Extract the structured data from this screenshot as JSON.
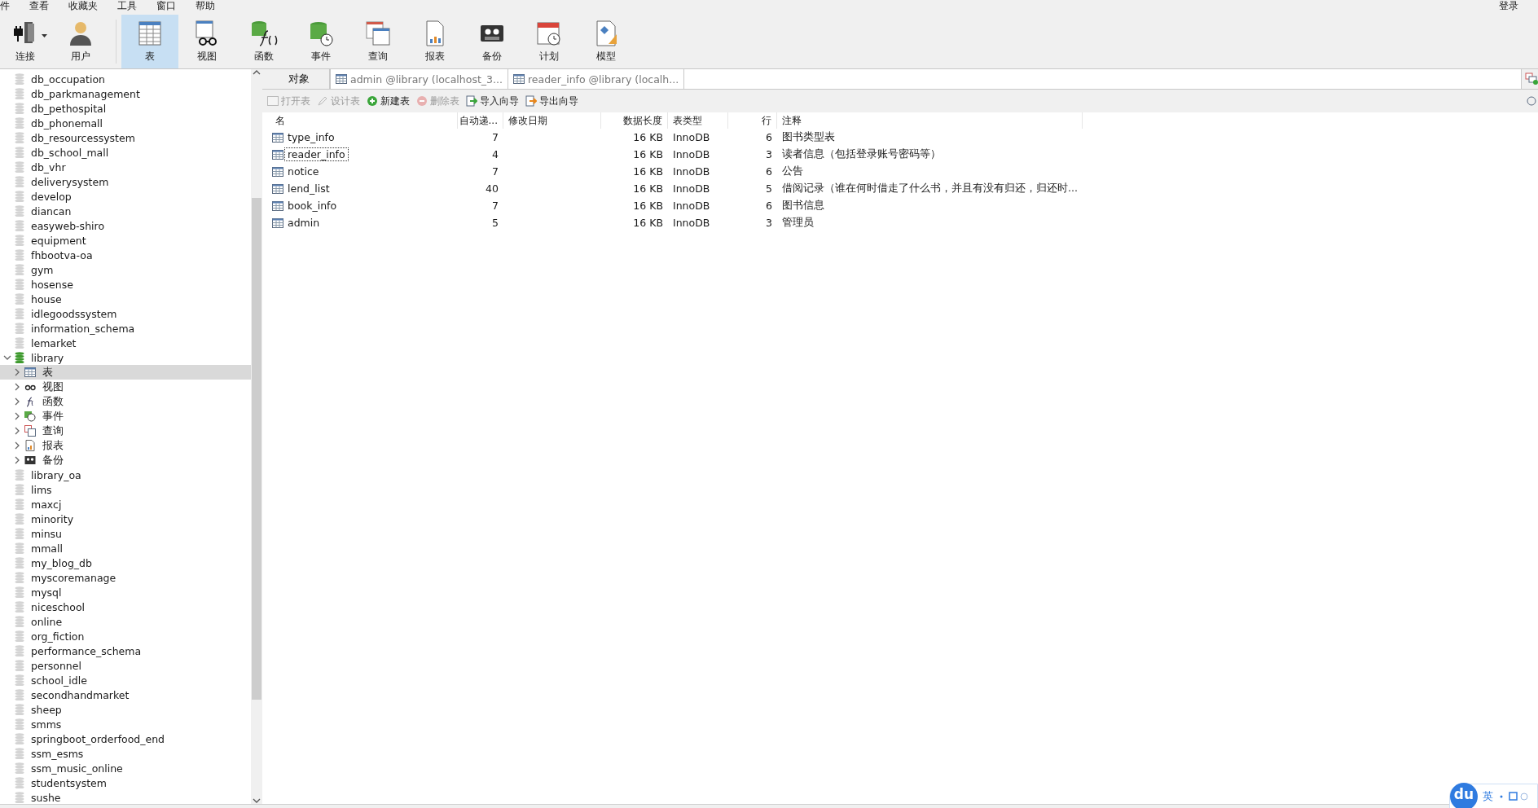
{
  "menu": [
    "件",
    "查看",
    "收藏夹",
    "工具",
    "窗口",
    "帮助"
  ],
  "login": "登录",
  "toolbar": [
    {
      "kind": "connect",
      "label": "连接",
      "selected": false,
      "dropdown": true
    },
    {
      "kind": "user",
      "label": "用户",
      "selected": false,
      "dropdown": false
    },
    {
      "kind": "separator"
    },
    {
      "kind": "table",
      "label": "表",
      "selected": true,
      "dropdown": false
    },
    {
      "kind": "view",
      "label": "视图",
      "selected": false,
      "dropdown": false
    },
    {
      "kind": "function",
      "label": "函数",
      "selected": false,
      "dropdown": false
    },
    {
      "kind": "event",
      "label": "事件",
      "selected": false,
      "dropdown": false
    },
    {
      "kind": "query",
      "label": "查询",
      "selected": false,
      "dropdown": false
    },
    {
      "kind": "report",
      "label": "报表",
      "selected": false,
      "dropdown": false
    },
    {
      "kind": "backup",
      "label": "备份",
      "selected": false,
      "dropdown": false
    },
    {
      "kind": "schedule",
      "label": "计划",
      "selected": false,
      "dropdown": false
    },
    {
      "kind": "model",
      "label": "模型",
      "selected": false,
      "dropdown": false
    }
  ],
  "sidebar": {
    "items": [
      {
        "kind": "database",
        "name": "db_occupation",
        "expanded": false
      },
      {
        "kind": "database",
        "name": "db_parkmanagement",
        "expanded": false
      },
      {
        "kind": "database",
        "name": "db_pethospital",
        "expanded": false
      },
      {
        "kind": "database",
        "name": "db_phonemall",
        "expanded": false
      },
      {
        "kind": "database",
        "name": "db_resourcessystem",
        "expanded": false
      },
      {
        "kind": "database",
        "name": "db_school_mall",
        "expanded": false
      },
      {
        "kind": "database",
        "name": "db_vhr",
        "expanded": false
      },
      {
        "kind": "database",
        "name": "deliverysystem",
        "expanded": false
      },
      {
        "kind": "database",
        "name": "develop",
        "expanded": false
      },
      {
        "kind": "database",
        "name": "diancan",
        "expanded": false
      },
      {
        "kind": "database",
        "name": "easyweb-shiro",
        "expanded": false
      },
      {
        "kind": "database",
        "name": "equipment",
        "expanded": false
      },
      {
        "kind": "database",
        "name": "fhbootva-oa",
        "expanded": false
      },
      {
        "kind": "database",
        "name": "gym",
        "expanded": false
      },
      {
        "kind": "database",
        "name": "hosense",
        "expanded": false
      },
      {
        "kind": "database",
        "name": "house",
        "expanded": false
      },
      {
        "kind": "database",
        "name": "idlegoodssystem",
        "expanded": false
      },
      {
        "kind": "database",
        "name": "information_schema",
        "expanded": false
      },
      {
        "kind": "database",
        "name": "lemarket",
        "expanded": false
      },
      {
        "kind": "database",
        "name": "library",
        "expanded": true,
        "children": [
          {
            "kind": "table",
            "name": "表",
            "expanded": false,
            "selected": true
          },
          {
            "kind": "view",
            "name": "视图",
            "expanded": false,
            "selected": false
          },
          {
            "kind": "function",
            "name": "函数",
            "expanded": false,
            "selected": false
          },
          {
            "kind": "event",
            "name": "事件",
            "expanded": false,
            "selected": false
          },
          {
            "kind": "query",
            "name": "查询",
            "expanded": false,
            "selected": false
          },
          {
            "kind": "report",
            "name": "报表",
            "expanded": false,
            "selected": false
          },
          {
            "kind": "backup",
            "name": "备份",
            "expanded": false,
            "selected": false
          }
        ]
      },
      {
        "kind": "database",
        "name": "library_oa",
        "expanded": false
      },
      {
        "kind": "database",
        "name": "lims",
        "expanded": false
      },
      {
        "kind": "database",
        "name": "maxcj",
        "expanded": false
      },
      {
        "kind": "database",
        "name": "minority",
        "expanded": false
      },
      {
        "kind": "database",
        "name": "minsu",
        "expanded": false
      },
      {
        "kind": "database",
        "name": "mmall",
        "expanded": false
      },
      {
        "kind": "database",
        "name": "my_blog_db",
        "expanded": false
      },
      {
        "kind": "database",
        "name": "myscoremanage",
        "expanded": false
      },
      {
        "kind": "database",
        "name": "mysql",
        "expanded": false
      },
      {
        "kind": "database",
        "name": "niceschool",
        "expanded": false
      },
      {
        "kind": "database",
        "name": "online",
        "expanded": false
      },
      {
        "kind": "database",
        "name": "org_fiction",
        "expanded": false
      },
      {
        "kind": "database",
        "name": "performance_schema",
        "expanded": false
      },
      {
        "kind": "database",
        "name": "personnel",
        "expanded": false
      },
      {
        "kind": "database",
        "name": "school_idle",
        "expanded": false
      },
      {
        "kind": "database",
        "name": "secondhandmarket",
        "expanded": false
      },
      {
        "kind": "database",
        "name": "sheep",
        "expanded": false
      },
      {
        "kind": "database",
        "name": "smms",
        "expanded": false
      },
      {
        "kind": "database",
        "name": "springboot_orderfood_end",
        "expanded": false
      },
      {
        "kind": "database",
        "name": "ssm_esms",
        "expanded": false
      },
      {
        "kind": "database",
        "name": "ssm_music_online",
        "expanded": false
      },
      {
        "kind": "database",
        "name": "studentsystem",
        "expanded": false
      },
      {
        "kind": "database",
        "name": "sushe",
        "expanded": false
      }
    ]
  },
  "tabs": [
    {
      "kind": "objects",
      "label": "对象",
      "selected": true
    },
    {
      "kind": "table",
      "label": "admin @library (localhost_3...",
      "selected": false
    },
    {
      "kind": "table",
      "label": "reader_info @library (localh...",
      "selected": false
    }
  ],
  "actions": [
    {
      "kind": "open",
      "label": "打开表",
      "disabled": true
    },
    {
      "kind": "design",
      "label": "设计表",
      "disabled": true
    },
    {
      "kind": "new",
      "label": "新建表",
      "disabled": false
    },
    {
      "kind": "delete",
      "label": "删除表",
      "disabled": true
    },
    {
      "kind": "import",
      "label": "导入向导",
      "disabled": false
    },
    {
      "kind": "export",
      "label": "导出向导",
      "disabled": false
    }
  ],
  "table": {
    "columns": [
      "名",
      "自动递...",
      "修改日期",
      "数据长度",
      "表类型",
      "行",
      "注释"
    ],
    "rows": [
      {
        "cells": [
          "type_info",
          "7",
          "",
          "16 KB",
          "InnoDB",
          "6",
          "图书类型表"
        ],
        "focused": false
      },
      {
        "cells": [
          "reader_info",
          "4",
          "",
          "16 KB",
          "InnoDB",
          "3",
          "读者信息（包括登录账号密码等）"
        ],
        "focused": true
      },
      {
        "cells": [
          "notice",
          "7",
          "",
          "16 KB",
          "InnoDB",
          "6",
          "公告"
        ],
        "focused": false
      },
      {
        "cells": [
          "lend_list",
          "40",
          "",
          "16 KB",
          "InnoDB",
          "5",
          "借阅记录（谁在何时借走了什么书，并且有没有归还，归还时..."
        ],
        "focused": false
      },
      {
        "cells": [
          "book_info",
          "7",
          "",
          "16 KB",
          "InnoDB",
          "6",
          "图书信息"
        ],
        "focused": false
      },
      {
        "cells": [
          "admin",
          "5",
          "",
          "16 KB",
          "InnoDB",
          "3",
          "管理员"
        ],
        "focused": false
      }
    ]
  },
  "ime": {
    "logo": "du",
    "mode": "英"
  }
}
